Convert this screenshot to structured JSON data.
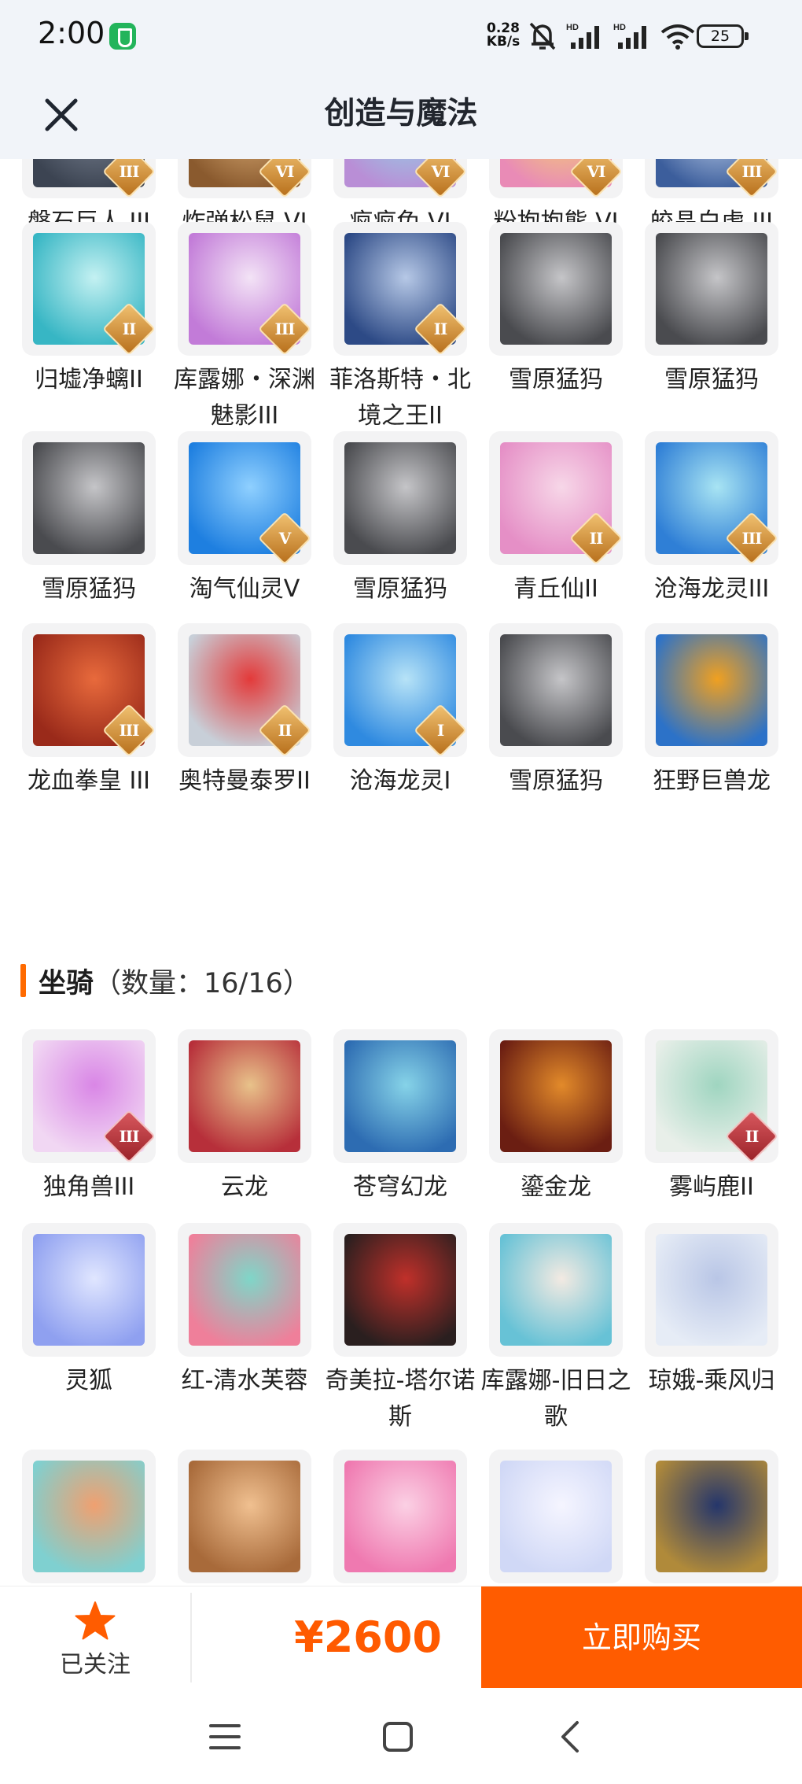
{
  "status_bar": {
    "time": "2:00",
    "rate_value": "0.28",
    "rate_unit": "KB/s",
    "battery": "25"
  },
  "header": {
    "title": "创造与魔法",
    "close_icon": "close-icon"
  },
  "pets_top": [
    {
      "name": "磐石巨人 III",
      "badge": "III",
      "c1": "#3c4452",
      "c2": "#7d8696"
    },
    {
      "name": "炸弹松鼠 VI",
      "badge": "VI",
      "c1": "#8a5a2e",
      "c2": "#e0b27a"
    },
    {
      "name": "疯疯兔 VI",
      "badge": "VI",
      "c1": "#b98ed6",
      "c2": "#8fd9e8"
    },
    {
      "name": "粉抱抱熊 VI",
      "badge": "VI",
      "c1": "#e98bb6",
      "c2": "#f5d86a"
    },
    {
      "name": "皎晶白虎 III",
      "badge": "III",
      "c1": "#3c5e9c",
      "c2": "#c8d8f0"
    },
    {
      "name": "归墟净螭II",
      "badge": "II",
      "c1": "#37b6c4",
      "c2": "#c4f1f2"
    },
    {
      "name": "库露娜・深渊魅影III",
      "badge": "III",
      "c1": "#c27bd8",
      "c2": "#f3e3f6"
    },
    {
      "name": "菲洛斯特・北境之王II",
      "badge": "II",
      "c1": "#2d4a86",
      "c2": "#b6c8e6"
    },
    {
      "name": "雪原猛犸",
      "badge": "",
      "c1": "#4a4b4f",
      "c2": "#c5c5c8"
    },
    {
      "name": "雪原猛犸",
      "badge": "",
      "c1": "#4a4b4f",
      "c2": "#c5c5c8"
    },
    {
      "name": "雪原猛犸",
      "badge": "",
      "c1": "#4a4b4f",
      "c2": "#c5c5c8"
    },
    {
      "name": "淘气仙灵V",
      "badge": "V",
      "c1": "#1e7fe0",
      "c2": "#8fd0ff"
    },
    {
      "name": "雪原猛犸",
      "badge": "",
      "c1": "#4a4b4f",
      "c2": "#c5c5c8"
    },
    {
      "name": "青丘仙II",
      "badge": "II",
      "c1": "#e58fc6",
      "c2": "#f7d7e8"
    },
    {
      "name": "沧海龙灵III",
      "badge": "III",
      "c1": "#2f7fd6",
      "c2": "#a8e4f3"
    },
    {
      "name": "龙血拳皇 III",
      "badge": "III",
      "c1": "#9a2a1a",
      "c2": "#e86a3c"
    },
    {
      "name": "奥特曼泰罗II",
      "badge": "II",
      "c1": "#c8cfd8",
      "c2": "#e33a3a"
    },
    {
      "name": "沧海龙灵I",
      "badge": "I",
      "c1": "#2f8ae0",
      "c2": "#b7e3f7"
    },
    {
      "name": "雪原猛犸",
      "badge": "",
      "c1": "#4a4b4f",
      "c2": "#c5c5c8"
    },
    {
      "name": "狂野巨兽龙",
      "badge": "",
      "c1": "#2c72c8",
      "c2": "#f0a020"
    }
  ],
  "mounts_section": {
    "label": "坐骑",
    "count": "（数量：16/16）"
  },
  "mounts": [
    {
      "name": "独角兽III",
      "badge": "III",
      "badge_color": "red",
      "c1": "#f1d7f3",
      "c2": "#d986e6"
    },
    {
      "name": "云龙",
      "badge": "",
      "c1": "#b72f3a",
      "c2": "#e8c28a"
    },
    {
      "name": "苍穹幻龙",
      "badge": "",
      "c1": "#2d6cb2",
      "c2": "#86d3e8"
    },
    {
      "name": "鎏金龙",
      "badge": "",
      "c1": "#6b1e12",
      "c2": "#e28a2a"
    },
    {
      "name": "雾屿鹿II",
      "badge": "II",
      "badge_color": "red",
      "c1": "#e8efe9",
      "c2": "#9fd5c0"
    },
    {
      "name": "灵狐",
      "badge": "",
      "c1": "#8fa0f0",
      "c2": "#e0e6ff"
    },
    {
      "name": "红-清水芙蓉",
      "badge": "",
      "c1": "#ef7f9a",
      "c2": "#7fd6c8"
    },
    {
      "name": "奇美拉-塔尔诺斯",
      "badge": "",
      "c1": "#2a1f1f",
      "c2": "#c0302a"
    },
    {
      "name": "库露娜-旧日之歌",
      "badge": "",
      "c1": "#67c2d6",
      "c2": "#f3eae2"
    },
    {
      "name": "琼娥-乘风归",
      "badge": "",
      "c1": "#e6ecf6",
      "c2": "#b9c6e6"
    },
    {
      "name": "",
      "badge": "",
      "c1": "#7fd0d0",
      "c2": "#f0a070"
    },
    {
      "name": "",
      "badge": "",
      "c1": "#a86a3a",
      "c2": "#f0c090"
    },
    {
      "name": "",
      "badge": "",
      "c1": "#ef79b0",
      "c2": "#fbd0e4"
    },
    {
      "name": "",
      "badge": "",
      "c1": "#d0d8f6",
      "c2": "#f5f5ff"
    },
    {
      "name": "",
      "badge": "",
      "c1": "#b08a3a",
      "c2": "#25366b"
    }
  ],
  "bottom_bar": {
    "follow_label": "已关注",
    "price": "¥2600",
    "buy_label": "立即购买"
  },
  "colors": {
    "accent": "#ff5c00",
    "header_bg": "#f1f4f9",
    "card_bg": "#f3f3f4"
  },
  "icons": {
    "star": "star-icon",
    "menu": "menu-icon",
    "home": "home-icon",
    "back": "back-icon"
  }
}
